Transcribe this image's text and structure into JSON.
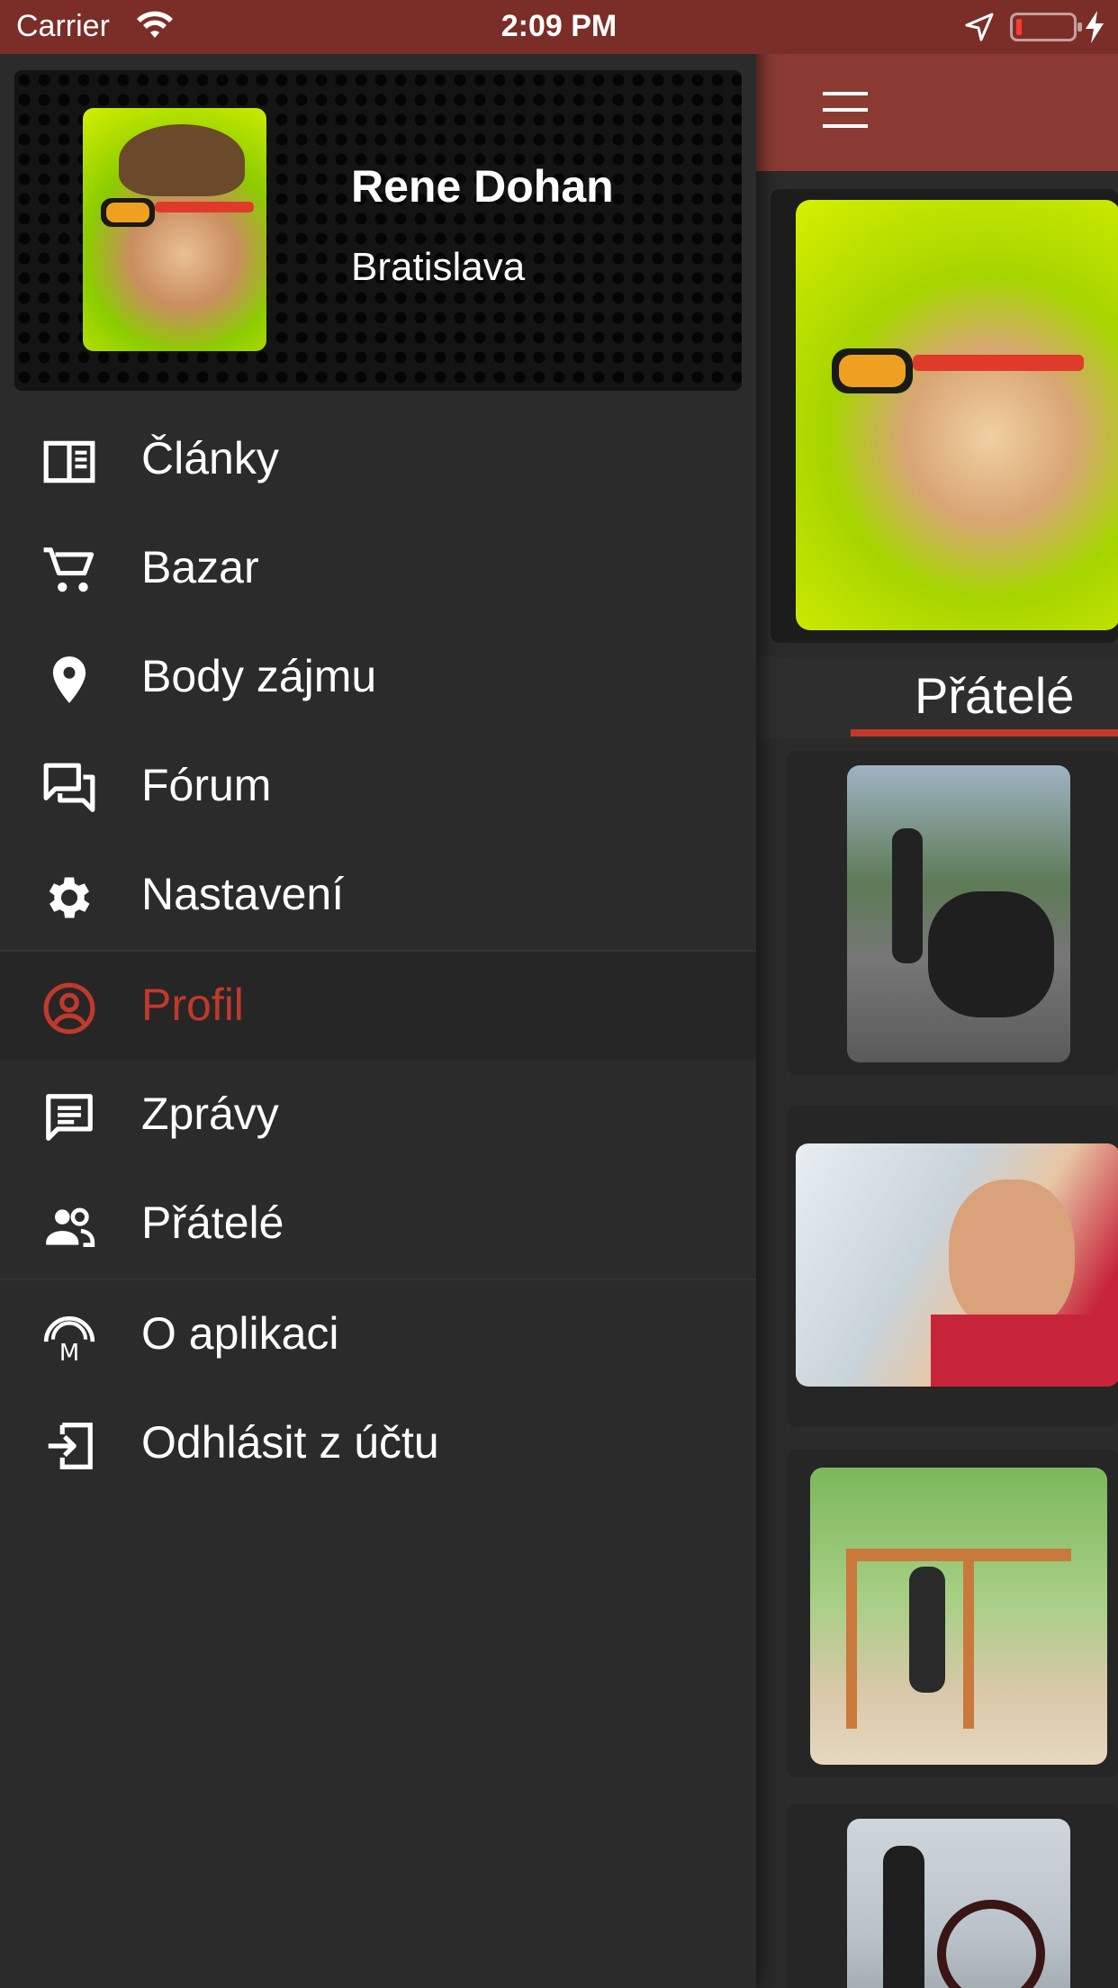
{
  "status_bar": {
    "carrier": "Carrier",
    "time": "2:09 PM",
    "icons": [
      "wifi-icon",
      "location-arrow-icon",
      "battery-icon",
      "charging-bolt-icon"
    ]
  },
  "drawer": {
    "user": {
      "name": "Rene Dohan",
      "city": "Bratislava"
    },
    "menu_groups": [
      [
        {
          "label": "Články",
          "icon": "article-icon"
        },
        {
          "label": "Bazar",
          "icon": "cart-icon"
        },
        {
          "label": "Body zájmu",
          "icon": "location-pin-icon"
        },
        {
          "label": "Fórum",
          "icon": "forum-icon"
        },
        {
          "label": "Nastavení",
          "icon": "gear-icon"
        }
      ],
      [
        {
          "label": "Profil",
          "icon": "profile-icon",
          "active": true
        },
        {
          "label": "Zprávy",
          "icon": "message-icon"
        },
        {
          "label": "Přátelé",
          "icon": "people-icon"
        }
      ],
      [
        {
          "label": "O aplikaci",
          "icon": "app-logo-icon"
        },
        {
          "label": "Odhlásit z účtu",
          "icon": "logout-icon"
        }
      ]
    ]
  },
  "content": {
    "tab": "Přátelé"
  },
  "colors": {
    "status_bar": "#7b2e28",
    "app_bar": "#8b3a33",
    "accent": "#c0392b",
    "drawer_bg": "#2b2b2b"
  }
}
